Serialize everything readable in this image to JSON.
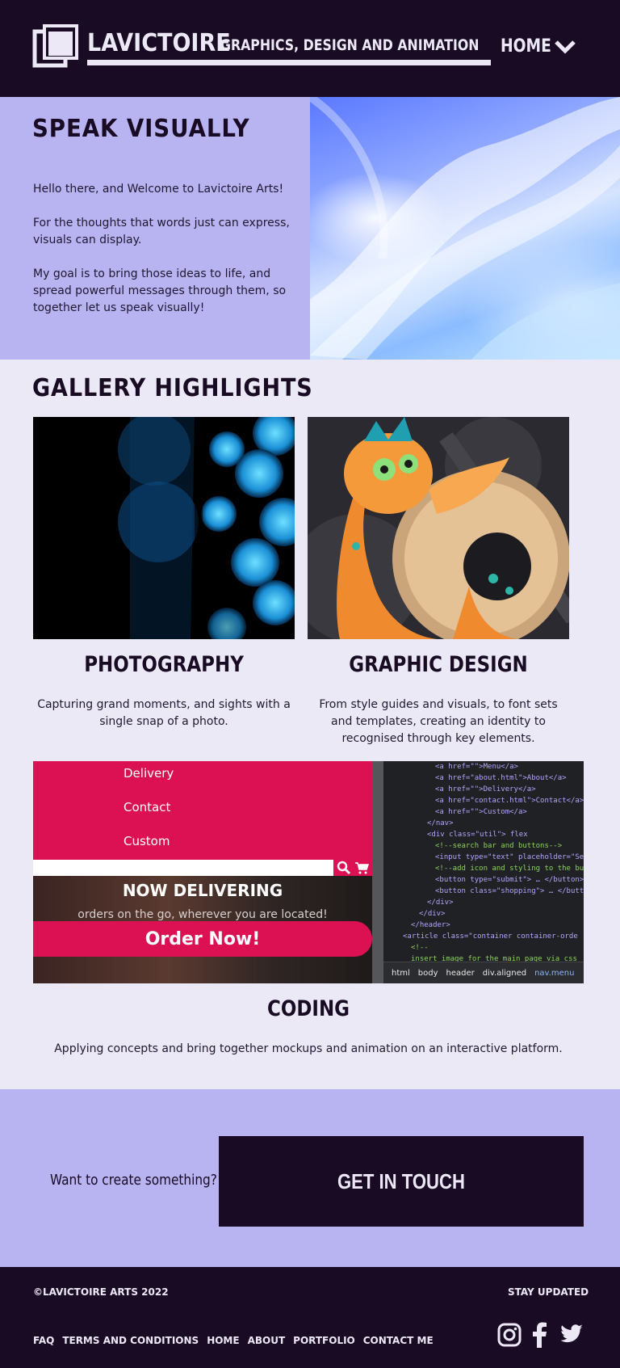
{
  "header": {
    "brand": "LAVICTOIRE",
    "tagline": "GRAPHICS, DESIGN AND ANIMATION",
    "nav_label": "HOME"
  },
  "hero": {
    "title": "SPEAK VISUALLY",
    "paragraphs": [
      "Hello there, and Welcome to Lavictoire Arts!",
      "For the thoughts that words just can express, visuals can display.",
      "My goal is to bring those ideas to life, and spread powerful messages through them, so together let us speak visually!"
    ]
  },
  "gallery": {
    "title": "GALLERY HIGHLIGHTS",
    "items": [
      {
        "title": "PHOTOGRAPHY",
        "description": "Capturing grand moments, and sights with a single snap of a photo."
      },
      {
        "title": "GRAPHIC DESIGN",
        "description": "From style guides and visuals, to font sets and templates, creating an identity to recognised through key elements."
      },
      {
        "title": "CODING",
        "description": "Applying concepts and bring together mockups and animation on an interactive platform."
      }
    ],
    "code_screenshot": {
      "menu_items": [
        "Delivery",
        "Contact",
        "Custom"
      ],
      "banner_title": "NOW DELIVERING",
      "banner_sub": "orders on the go, wherever you are located!",
      "order_button": "Order Now!",
      "code_lines": [
        "<a href=\"\">Menu</a>",
        "<a href=\"about.html\">About</a>",
        "<a href=\"\">Delivery</a>",
        "<a href=\"contact.html\">Contact</a>",
        "<a href=\"\">Custom</a>",
        "</nav>",
        "<div class=\"util\"> flex",
        "<!--search bar and buttons-->",
        "<input type=\"text\" placeholder=\"Sea",
        "<!--add icon and styling to the but",
        "<button type=\"submit\"> … </button>",
        "<button class=\"shopping\"> … </butto",
        "</div>",
        "</div>",
        "</header>",
        "<article class=\"container container-orde",
        "<!--",
        "insert image for the main page via css"
      ],
      "breadcrumb": [
        "html",
        "body",
        "header",
        "div.aligned",
        "nav.menu"
      ]
    }
  },
  "cta": {
    "prompt": "Want to create something?",
    "button_label": "GET IN TOUCH"
  },
  "footer": {
    "copyright": "©LAVICTOIRE ARTS 2022",
    "stay_updated": "STAY UPDATED",
    "links": [
      "FAQ",
      "TERMS AND CONDITIONS",
      "HOME",
      "ABOUT",
      "PORTFOLIO",
      "CONTACT ME"
    ],
    "social_icons": [
      "instagram-icon",
      "facebook-icon",
      "twitter-icon"
    ]
  },
  "colors": {
    "dark": "#1a0b24",
    "lavender": "#b8b3f1",
    "light": "#ece9f6",
    "accent_pink": "#dc1154"
  }
}
